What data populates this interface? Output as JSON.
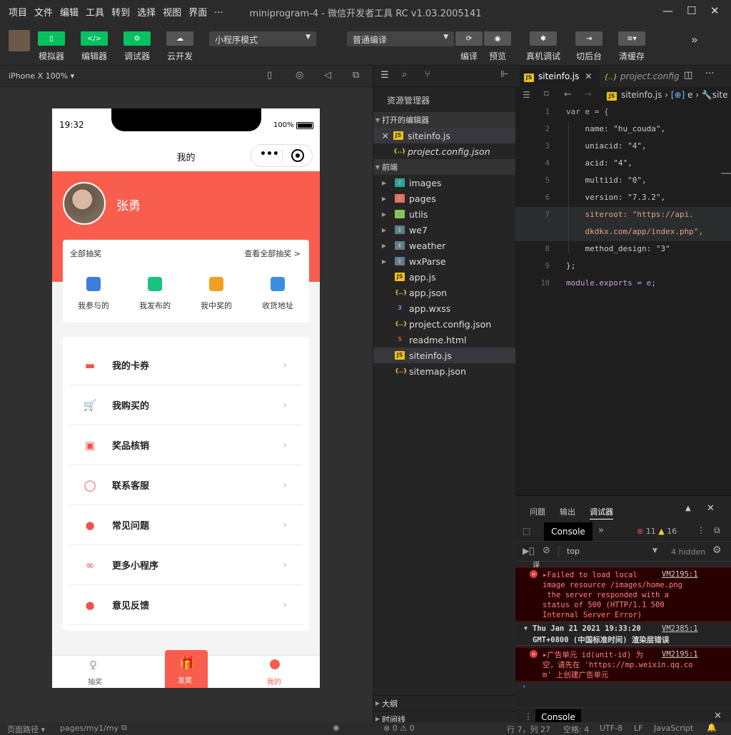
{
  "titlebar": {
    "menu": [
      "项目",
      "文件",
      "编辑",
      "工具",
      "转到",
      "选择",
      "视图",
      "界面",
      "..."
    ],
    "title": "miniprogram-4 - 微信开发者工具 RC v1.03.2005141"
  },
  "toolbar": {
    "simulator": "模拟器",
    "editor": "编辑器",
    "debugger": "调试器",
    "cloud": "云开发",
    "mode": "小程序模式",
    "compile": "普通编译",
    "compile_btn": "编译",
    "preview": "预览",
    "real_debug": "真机调试",
    "background": "切后台",
    "clear_cache": "清缓存"
  },
  "sim": {
    "device": "iPhone X 100%"
  },
  "phone": {
    "time": "19:32",
    "battery": "100%",
    "nav_title": "我的",
    "username": "张勇",
    "lottery": {
      "title": "全部抽奖",
      "link": "查看全部抽奖 >",
      "items": [
        {
          "label": "我参与的",
          "icon": "coins-icon",
          "color": "#3b7ddd"
        },
        {
          "label": "我发布的",
          "icon": "bag-icon",
          "color": "#19c37d"
        },
        {
          "label": "我中奖的",
          "icon": "moneybag-icon",
          "color": "#f0a020"
        },
        {
          "label": "收货地址",
          "icon": "home-icon",
          "color": "#3a8ee6"
        }
      ]
    },
    "menu": [
      {
        "label": "我的卡券",
        "icon": "card-icon"
      },
      {
        "label": "我购买的",
        "icon": "cart-icon"
      },
      {
        "label": "奖品核销",
        "icon": "wallet-icon"
      },
      {
        "label": "联系客服",
        "icon": "chat-icon"
      },
      {
        "label": "常见问题",
        "icon": "user-icon"
      },
      {
        "label": "更多小程序",
        "icon": "link-icon"
      },
      {
        "label": "意见反馈",
        "icon": "feedback-icon"
      }
    ],
    "tabbar": {
      "lottery": "抽奖",
      "publish": "发奖",
      "mine": "我的"
    }
  },
  "explorer": {
    "header": "资源管理器",
    "open_editors": "打开的编辑器",
    "open_files": [
      "siteinfo.js",
      "project.config.json"
    ],
    "project": "前端",
    "tree": [
      {
        "name": "images",
        "type": "folder"
      },
      {
        "name": "pages",
        "type": "folder"
      },
      {
        "name": "utils",
        "type": "folder"
      },
      {
        "name": "we7",
        "type": "folder"
      },
      {
        "name": "weather",
        "type": "folder"
      },
      {
        "name": "wxParse",
        "type": "folder"
      },
      {
        "name": "app.js",
        "type": "js"
      },
      {
        "name": "app.json",
        "type": "json"
      },
      {
        "name": "app.wxss",
        "type": "css"
      },
      {
        "name": "project.config.json",
        "type": "json"
      },
      {
        "name": "readme.html",
        "type": "html"
      },
      {
        "name": "siteinfo.js",
        "type": "js"
      },
      {
        "name": "sitemap.json",
        "type": "json"
      }
    ],
    "outline": "大纲",
    "timeline": "时间线"
  },
  "editor": {
    "tabs": [
      "siteinfo.js",
      "project.config"
    ],
    "breadcrumb": "siteinfo.js",
    "bc_symbol": "e",
    "bc_extra": "site",
    "lines": [
      {
        "n": "1",
        "t": "var e = {"
      },
      {
        "n": "2",
        "t": "    name: \"hu_couda\","
      },
      {
        "n": "3",
        "t": "    uniacid: \"4\","
      },
      {
        "n": "4",
        "t": "    acid: \"4\","
      },
      {
        "n": "5",
        "t": "    multiid: \"0\","
      },
      {
        "n": "6",
        "t": "    version: \"7.3.2\","
      },
      {
        "n": "7",
        "t": "    siteroot: \"https://api."
      },
      {
        "n": "",
        "t": "    dkdkx.com/app/index.php\","
      },
      {
        "n": "8",
        "t": "    method_design: \"3\""
      },
      {
        "n": "9",
        "t": "};"
      },
      {
        "n": "10",
        "t": "module.exports = e;"
      }
    ]
  },
  "debug": {
    "tabs": [
      "问题",
      "输出",
      "调试器"
    ],
    "console": "Console",
    "errors": "11",
    "warnings": "16",
    "context": "top",
    "hidden": "4 hidden",
    "msg1_lines": [
      "▸Failed to load local",
      "image resource /images/home.png",
      " the server responded with a",
      "status of 500 (HTTP/1.1 500",
      "Internal Server Error)"
    ],
    "msg1_src": "VM2195:1",
    "group_line1": "Thu Jan 21 2021 19:33:20",
    "group_line2": "GMT+0800 (中国标准时间) 渲染层错误",
    "group_src": "VM2385:1",
    "msg2_lines": [
      "▸广告单元 id(unit-id) 为",
      "空，请先在 'https://mp.weixin.qq.co",
      "m' 上创建广告单元"
    ],
    "msg2_src": "VM2195:1",
    "drawer": "Console"
  },
  "status": {
    "path_label": "页面路径",
    "path": "pages/my1/my",
    "problems": "⊗ 0 ⚠ 0",
    "pos": "行 7，列 27",
    "indent": "空格: 4",
    "enc": "UTF-8",
    "eol": "LF",
    "lang": "JavaScript"
  }
}
